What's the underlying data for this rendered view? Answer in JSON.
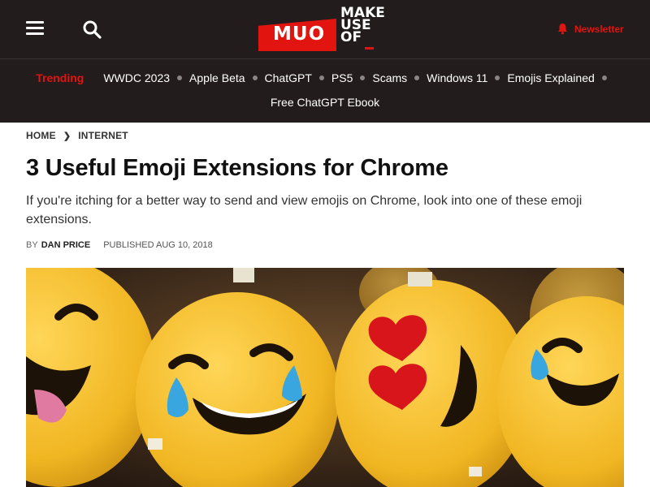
{
  "header": {
    "logo": {
      "box_text": "MUO",
      "line1": "MAKE",
      "line2": "USE",
      "line3": "OF"
    },
    "newsletter_label": "Newsletter",
    "colors": {
      "accent": "#e2140f",
      "bg": "#231c1c"
    }
  },
  "trending": {
    "label": "Trending",
    "row1": [
      "WWDC 2023",
      "Apple Beta",
      "ChatGPT",
      "PS5",
      "Scams",
      "Windows 11",
      "Emojis Explained"
    ],
    "row2": [
      "Free ChatGPT Ebook"
    ]
  },
  "breadcrumb": {
    "home": "HOME",
    "section": "INTERNET"
  },
  "article": {
    "title": "3 Useful Emoji Extensions for Chrome",
    "excerpt": "If you're itching for a better way to send and view emojis on Chrome, look into one of these emoji extensions.",
    "by": "BY",
    "author": "DAN PRICE",
    "published": "PUBLISHED AUG 10, 2018"
  },
  "icons": {
    "menu": "hamburger-menu-icon",
    "search": "search-icon",
    "newsletter": "bell-icon"
  }
}
